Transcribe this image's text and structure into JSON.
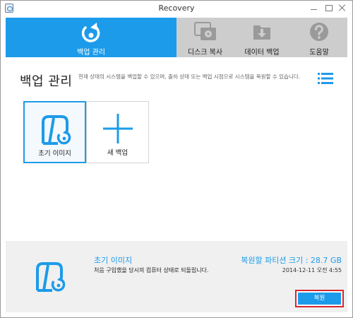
{
  "window": {
    "title": "Recovery"
  },
  "tabs": [
    {
      "label": "백업 관리",
      "icon": "backup-refresh-icon",
      "active": true
    },
    {
      "label": "디스크 복사",
      "icon": "disk-copy-icon",
      "active": false
    },
    {
      "label": "데이터 백업",
      "icon": "data-download-icon",
      "active": false
    },
    {
      "label": "도움말",
      "icon": "help-question-icon",
      "active": false
    }
  ],
  "page": {
    "title": "백업 관리",
    "description": "현재 상태의 시스템을 백업할 수 있으며, 출하 상태 또는 백업 시점으로 시스템을 복원할 수 있습니다."
  },
  "cards": [
    {
      "label": "초기 이미지",
      "icon": "initial-image-icon",
      "selected": true
    },
    {
      "label": "새 백업",
      "icon": "plus-icon",
      "selected": false
    }
  ],
  "selection": {
    "name": "초기 이미지",
    "description": "처음 구입했을 당시의 컴퓨터 상태로 되돌립니다.",
    "size_label": "복원할 파티션 크기 : 28.7 GB",
    "date": "2014-12-11 오전 4:55",
    "restore_label": "복원"
  },
  "colors": {
    "accent": "#1c9bea",
    "tab_inactive": "#cdcdcd",
    "footer_bg": "#f0f0f0",
    "highlight_border": "#d8262d"
  }
}
